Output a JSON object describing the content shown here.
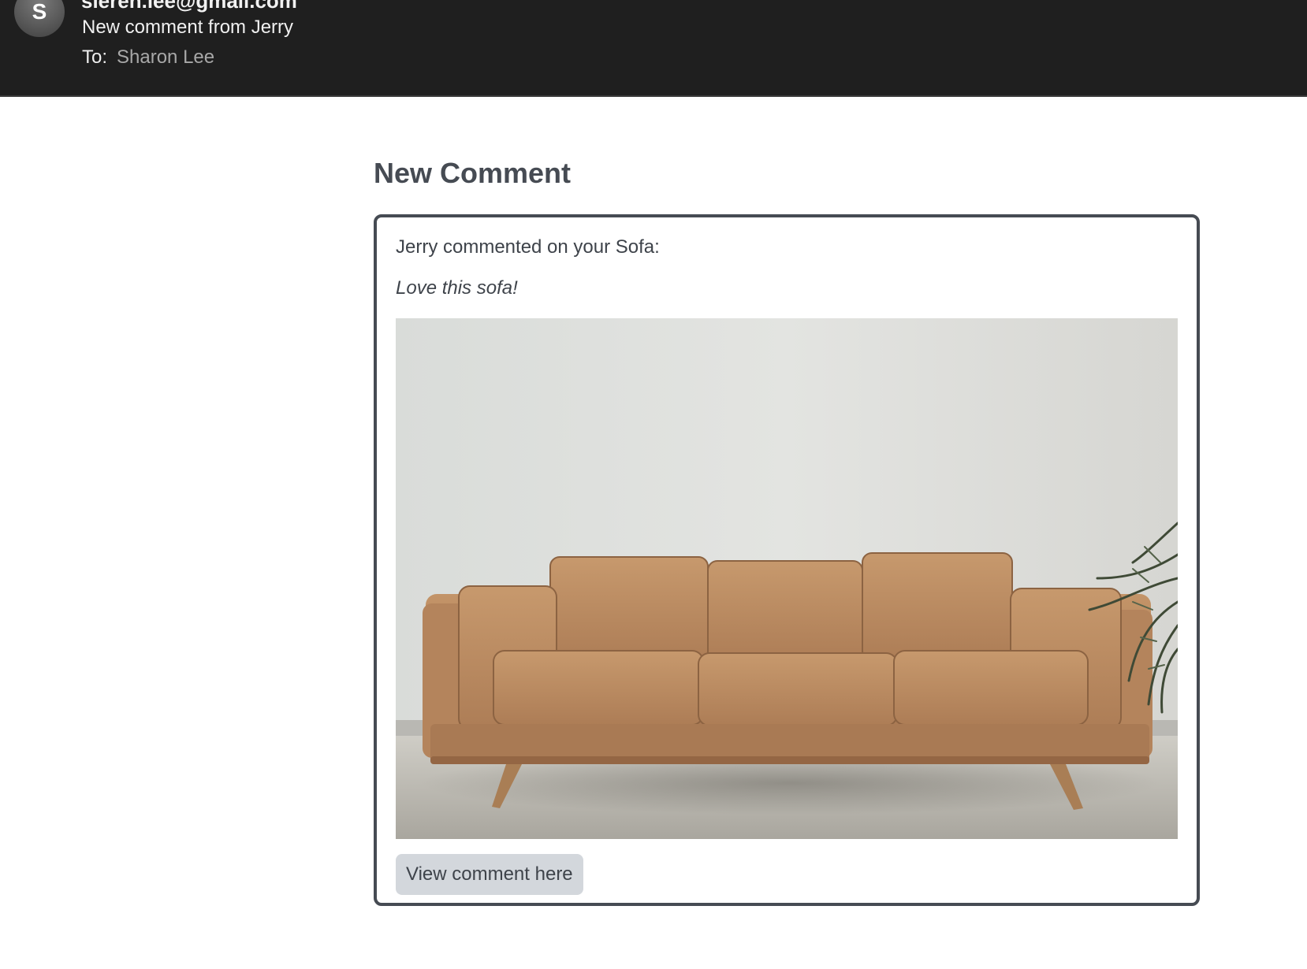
{
  "email": {
    "avatar_letter": "S",
    "sender": "sieren.lee@gmail.com",
    "subject": "New comment from Jerry",
    "to_label": "To:",
    "to_name": "Sharon Lee"
  },
  "main": {
    "title": "New Comment",
    "intro": "Jerry commented on your Sofa:",
    "comment": "Love this sofa!",
    "button_label": "View comment here"
  },
  "colors": {
    "header_bg": "#1f1f1f",
    "text_dark": "#464b53",
    "button_bg": "#d3d7dc",
    "sofa_leather": "#b88a5e"
  }
}
